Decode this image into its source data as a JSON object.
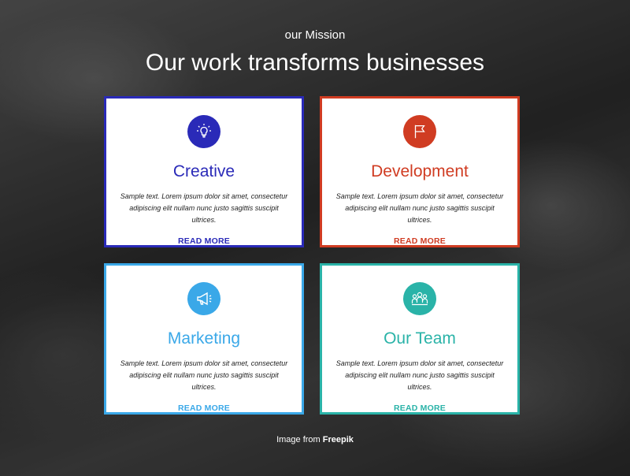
{
  "header": {
    "subtitle": "our Mission",
    "title": "Our work transforms businesses"
  },
  "cards": [
    {
      "title": "Creative",
      "text": "Sample text. Lorem ipsum dolor sit amet, consectetur adipiscing elit nullam nunc justo sagittis suscipit ultrices.",
      "link": "READ MORE",
      "icon": "lightbulb-icon",
      "color": "#2a2ab8"
    },
    {
      "title": "Development",
      "text": "Sample text. Lorem ipsum dolor sit amet, consectetur adipiscing elit nullam nunc justo sagittis suscipit ultrices.",
      "link": "READ MORE",
      "icon": "flag-icon",
      "color": "#d03c22"
    },
    {
      "title": "Marketing",
      "text": "Sample text. Lorem ipsum dolor sit amet, consectetur adipiscing elit nullam nunc justo sagittis suscipit ultrices.",
      "link": "READ MORE",
      "icon": "megaphone-icon",
      "color": "#3aa8e8"
    },
    {
      "title": "Our Team",
      "text": "Sample text. Lorem ipsum dolor sit amet, consectetur adipiscing elit nullam nunc justo sagittis suscipit ultrices.",
      "link": "READ MORE",
      "icon": "team-icon",
      "color": "#2ab3a8"
    }
  ],
  "footer": {
    "prefix": "Image from",
    "link": "Freepik"
  }
}
